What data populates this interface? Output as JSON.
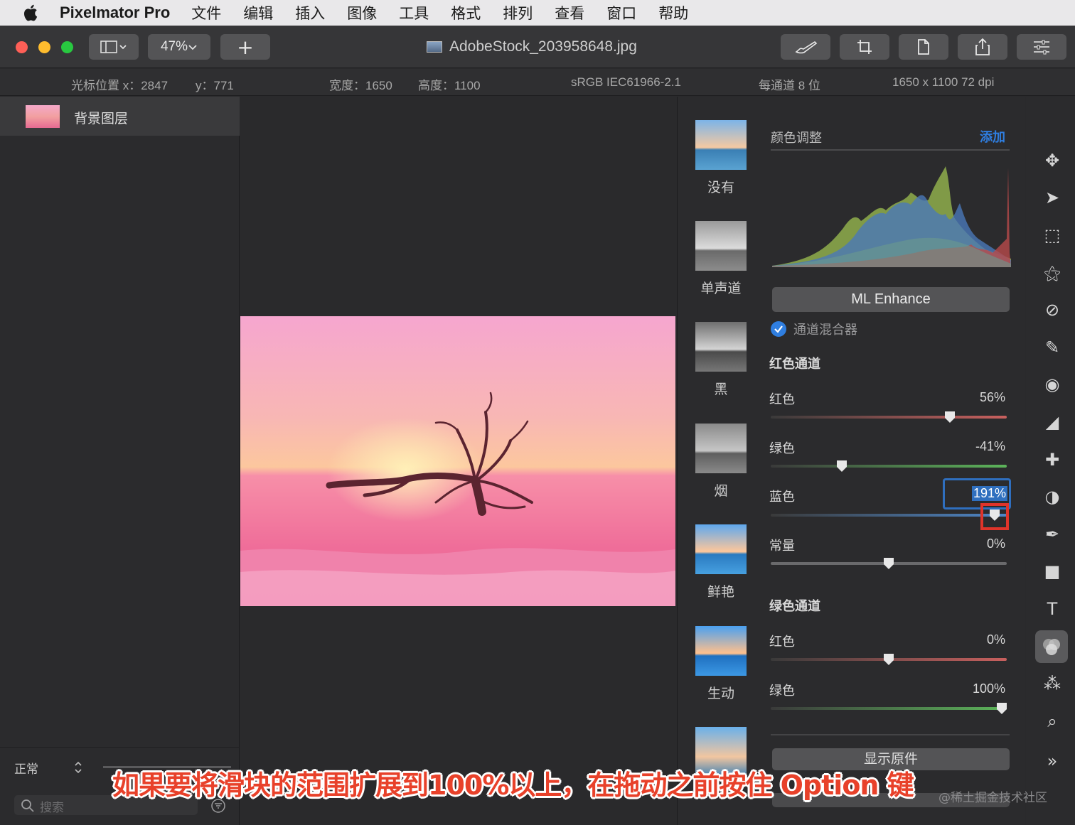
{
  "menubar": {
    "app_name": "Pixelmator Pro",
    "items": [
      "文件",
      "编辑",
      "插入",
      "图像",
      "工具",
      "格式",
      "排列",
      "查看",
      "窗口",
      "帮助"
    ]
  },
  "toolbar": {
    "zoom": "47%",
    "add_label": "+",
    "doc_title": "AdobeStock_203958648.jpg"
  },
  "infobar": {
    "cursor_x": "光标位置 x：2847",
    "cursor_y": "y：771",
    "width": "宽度：1650",
    "height": "高度：1100",
    "profile": "sRGB IEC61966-2.1",
    "bits": "每通道 8 位",
    "resolution": "1650 x 1100 72 dpi"
  },
  "layers": {
    "items": [
      {
        "name": "背景图层"
      }
    ],
    "blend_mode": "正常",
    "search_placeholder": "搜索"
  },
  "presets": {
    "items": [
      {
        "label": "没有"
      },
      {
        "label": "单声道"
      },
      {
        "label": "黑"
      },
      {
        "label": "烟"
      },
      {
        "label": "鲜艳"
      },
      {
        "label": "生动"
      }
    ]
  },
  "adjust": {
    "header": "颜色调整",
    "add_label": "添加",
    "ml_enhance": "ML Enhance",
    "mixer_title": "通道混合器",
    "red_channel": {
      "title": "红色通道",
      "red": {
        "label": "红色",
        "value": "56%",
        "level": 0.76
      },
      "green": {
        "label": "绿色",
        "value": "-41%",
        "level": 0.3
      },
      "blue": {
        "label": "蓝色",
        "value": "191%",
        "level": 0.95
      },
      "constant": {
        "label": "常量",
        "value": "0%",
        "level": 0.5
      }
    },
    "green_channel": {
      "title": "绿色通道",
      "red": {
        "label": "红色",
        "value": "0%",
        "level": 0.5
      },
      "green": {
        "label": "绿色",
        "value": "100%",
        "level": 0.98
      }
    },
    "show_original": "显示原件"
  },
  "colors": {
    "accent": "#2f7ee0",
    "highlight_box": "#e0342a"
  },
  "caption": "如果要将滑块的范围扩展到100%以上，在拖动之前按住 Option 键",
  "watermark": "@稀土掘金技术社区"
}
